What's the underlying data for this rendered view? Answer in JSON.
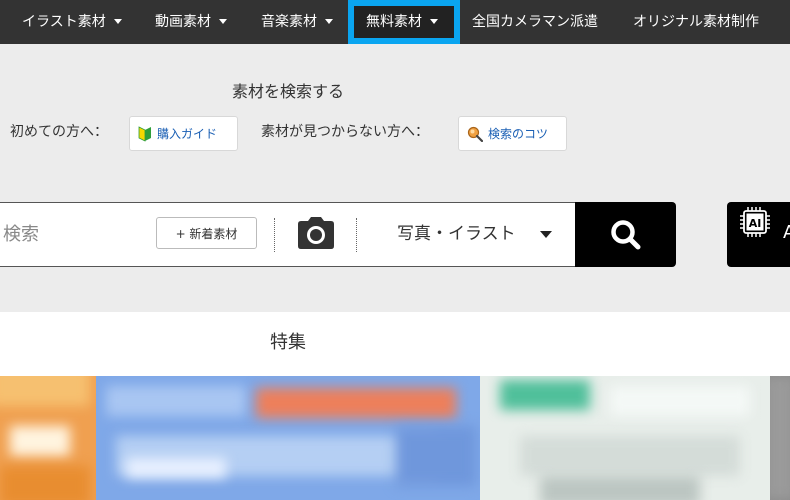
{
  "nav": {
    "items": [
      {
        "label": "イラスト素材"
      },
      {
        "label": "動画素材"
      },
      {
        "label": "音楽素材"
      },
      {
        "label": "無料素材"
      },
      {
        "label": "全国カメラマン派遣"
      },
      {
        "label": "オリジナル素材制作"
      }
    ],
    "highlight_color": "#0aa5f0"
  },
  "search": {
    "title": "素材を検索する",
    "first_time_label": "初めての方へ：",
    "purchase_guide_label": "購入ガイド",
    "not_found_label": "素材が見つからない方へ：",
    "search_tips_label": "検索のコツ",
    "placeholder": "検索",
    "new_materials_label": "+ 新着素材",
    "category_value": "写真・イラスト",
    "ai_label": "AI",
    "ai_button_label": "A"
  },
  "features": {
    "title": "特集"
  },
  "colors": {
    "nav_bg": "#333333",
    "search_button_bg": "#000000",
    "link": "#1a5fb4",
    "beginner_mark_green": "#2e9e3a",
    "beginner_mark_yellow": "#f5d800"
  },
  "icons": [
    "caret-down-icon",
    "beginner-mark-icon",
    "magnifier-icon",
    "camera-icon",
    "search-icon",
    "ai-chip-icon"
  ]
}
